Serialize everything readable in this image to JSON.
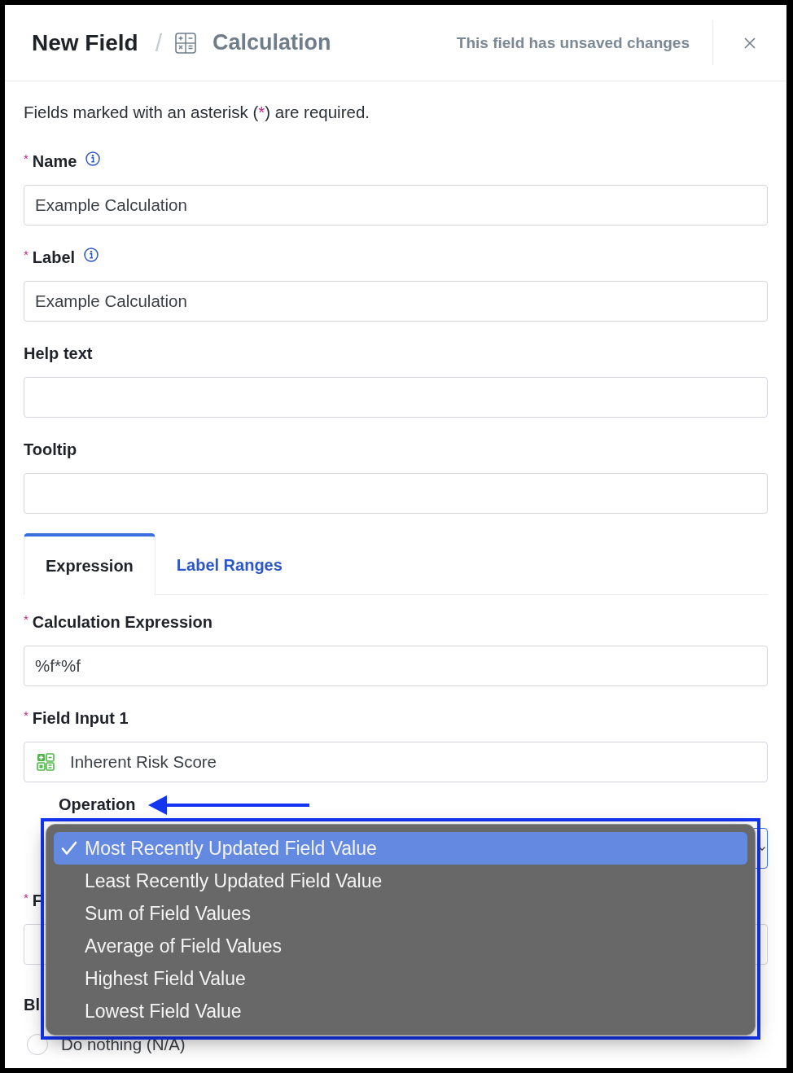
{
  "header": {
    "title": "New Field",
    "separator": "/",
    "field_type": "Calculation",
    "status": "This field has unsaved changes"
  },
  "required_note": {
    "before": "Fields marked with an asterisk (",
    "mark": "*",
    "after": ") are required."
  },
  "fields": [
    {
      "label": "Name",
      "mark": "*",
      "info": true,
      "value": "Example Calculation"
    },
    {
      "label": "Label",
      "mark": "*",
      "info": true,
      "value": "Example Calculation"
    },
    {
      "label": "Help text",
      "info": false
    },
    {
      "label": "Tooltip",
      "info": false
    }
  ],
  "tabs": [
    {
      "label": "Expression",
      "selected": true
    },
    {
      "label": "Label Ranges",
      "selected": false
    }
  ],
  "expression_fields": [
    {
      "kind": "text",
      "label": "Calculation Expression",
      "mark": "*",
      "value": "%f*%f"
    },
    {
      "kind": "field_picker",
      "label": "Field Input 1",
      "mark": "*",
      "value": "Inherent Risk Score",
      "children": [
        {
          "kind": "select",
          "label": "Operation",
          "focused": true
        }
      ]
    },
    {
      "kind": "text",
      "label": "F",
      "mark": "*"
    }
  ],
  "blank_handling": {
    "label": "Bl",
    "options": [
      {
        "label": "Do nothing (N/A)",
        "selected": false
      }
    ]
  },
  "operation_menu": {
    "items": [
      {
        "label": "Most Recently Updated Field Value",
        "selected": true
      },
      {
        "label": "Least Recently Updated Field Value",
        "selected": false
      },
      {
        "label": "Sum of Field Values",
        "selected": false
      },
      {
        "label": "Average of Field Values",
        "selected": false
      },
      {
        "label": "Highest Field Value",
        "selected": false
      },
      {
        "label": "Lowest Field Value",
        "selected": false
      }
    ]
  }
}
